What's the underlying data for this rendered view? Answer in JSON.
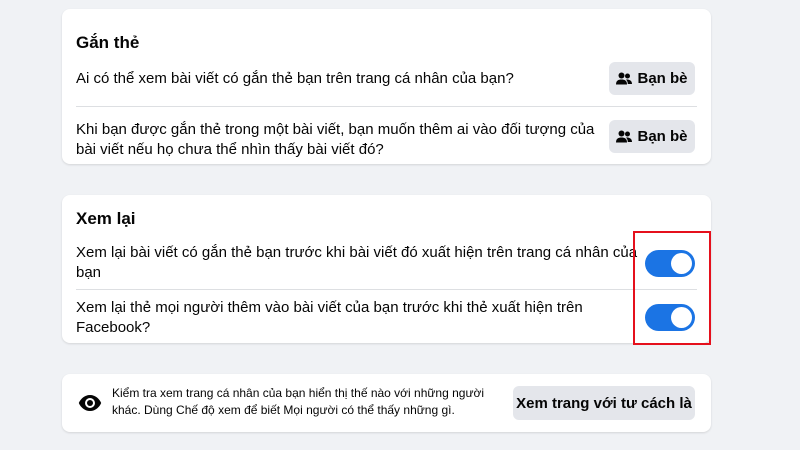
{
  "tagging": {
    "title": "Gắn thẻ",
    "rows": [
      {
        "question_line1": "Ai có thể xem bài viết có gắn thẻ bạn trên trang cá nhân của bạn?",
        "question_line2": "",
        "button_label": "Bạn bè",
        "button_icon": "friends-icon"
      },
      {
        "question_line1": "Khi bạn được gắn thẻ trong một bài viết, bạn muốn thêm ai vào đối tượng của",
        "question_line2": "bài viết nếu họ chưa thể nhìn thấy bài viết đó?",
        "button_label": "Bạn bè",
        "button_icon": "friends-icon"
      }
    ]
  },
  "review": {
    "title": "Xem lại",
    "rows": [
      {
        "question_line1": "Xem lại bài viết có gắn thẻ bạn trước khi bài viết đó xuất hiện trên trang cá nhân của",
        "question_line2": "bạn",
        "toggle_on": true
      },
      {
        "question_line1": "Xem lại thẻ mọi người thêm vào bài viết của bạn trước khi thẻ xuất hiện trên",
        "question_line2": "Facebook?",
        "toggle_on": true
      }
    ]
  },
  "view_as": {
    "icon": "eye-icon",
    "text_line1": "Kiểm tra xem trang cá nhân của bạn hiển thị thế nào với những người",
    "text_line2": "khác. Dùng Chế độ xem để biết Mọi người có thể thấy những gì.",
    "button_label": "Xem trang với tư cách là"
  },
  "colors": {
    "toggle_on": "#1b74e4",
    "highlight_border": "#e5101c",
    "background": "#f0f2f5"
  }
}
